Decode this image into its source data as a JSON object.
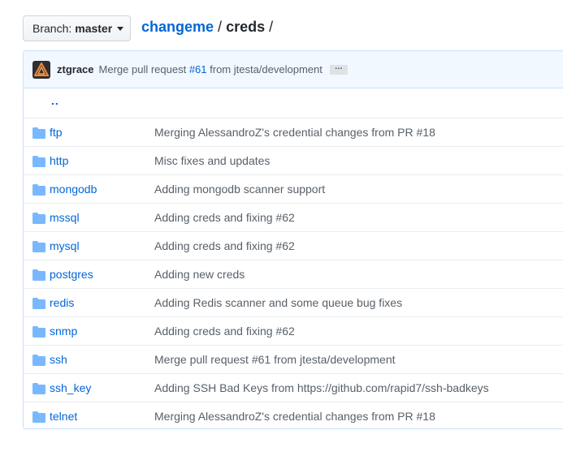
{
  "branch": {
    "prefix": "Branch:",
    "name": "master"
  },
  "breadcrumb": {
    "repo": "changeme",
    "sep1": "/",
    "dir": "creds",
    "sep2": "/"
  },
  "commit": {
    "author": "ztgrace",
    "message_prefix": "Merge pull request ",
    "pr_link": "#61",
    "message_suffix": " from jtesta/development",
    "ellipsis": "…"
  },
  "parent_dir": "..",
  "files": [
    {
      "name": "ftp",
      "message": "Merging AlessandroZ's credential changes from PR #18"
    },
    {
      "name": "http",
      "message": "Misc fixes and updates"
    },
    {
      "name": "mongodb",
      "message": "Adding mongodb scanner support"
    },
    {
      "name": "mssql",
      "message": "Adding creds and fixing #62"
    },
    {
      "name": "mysql",
      "message": "Adding creds and fixing #62"
    },
    {
      "name": "postgres",
      "message": "Adding new creds"
    },
    {
      "name": "redis",
      "message": "Adding Redis scanner and some queue bug fixes"
    },
    {
      "name": "snmp",
      "message": "Adding creds and fixing #62"
    },
    {
      "name": "ssh",
      "message": "Merge pull request #61 from jtesta/development"
    },
    {
      "name": "ssh_key",
      "message": "Adding SSH Bad Keys from https://github.com/rapid7/ssh-badkeys"
    },
    {
      "name": "telnet",
      "message": "Merging AlessandroZ's credential changes from PR #18"
    }
  ],
  "colors": {
    "link": "#0366d6",
    "folder_icon": "#79b8ff",
    "commit_bg": "#f1f8ff"
  }
}
